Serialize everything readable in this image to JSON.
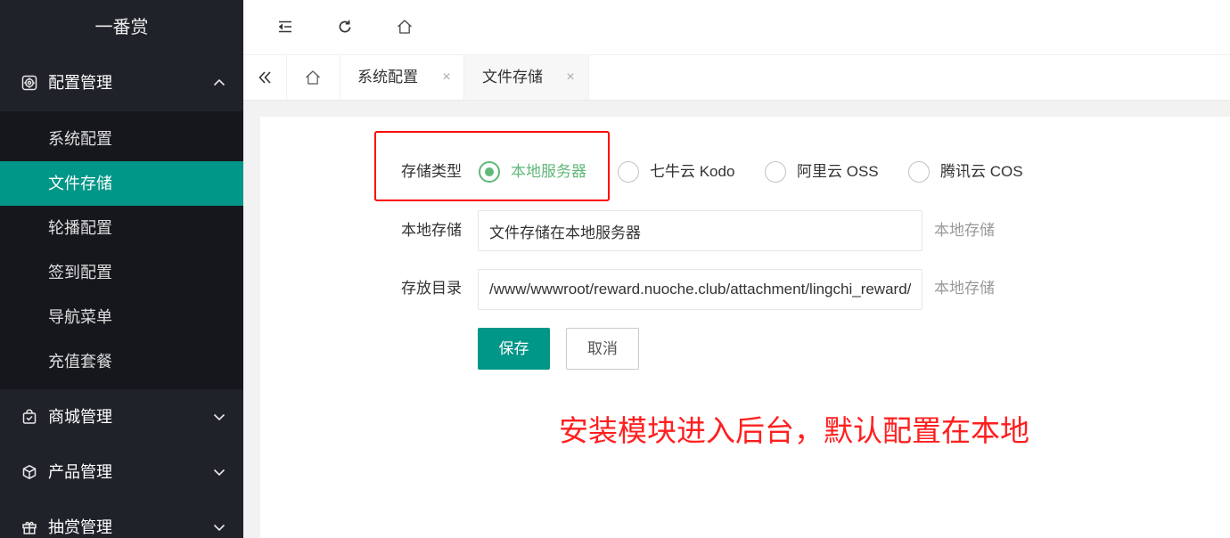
{
  "sidebar": {
    "logo": "一番赏",
    "groups": [
      {
        "label": "配置管理",
        "icon": "settings-icon",
        "expanded": true,
        "items": [
          {
            "label": "系统配置"
          },
          {
            "label": "文件存储",
            "active": true
          },
          {
            "label": "轮播配置"
          },
          {
            "label": "签到配置"
          },
          {
            "label": "导航菜单"
          },
          {
            "label": "充值套餐"
          }
        ]
      },
      {
        "label": "商城管理",
        "icon": "shopping-bag-check-icon",
        "expanded": false
      },
      {
        "label": "产品管理",
        "icon": "cube-icon",
        "expanded": false
      },
      {
        "label": "抽赏管理",
        "icon": "gift-icon",
        "expanded": false
      }
    ]
  },
  "header": {
    "icons": [
      "menu-fold-icon",
      "refresh-icon",
      "home-icon"
    ]
  },
  "tabs": {
    "collapse_icon": "double-chevron-left-icon",
    "home_icon": "home-icon",
    "items": [
      {
        "label": "系统配置",
        "close": "×"
      },
      {
        "label": "文件存储",
        "close": "×",
        "active": true
      }
    ]
  },
  "form": {
    "storage_type": {
      "label": "存储类型",
      "options": [
        {
          "label": "本地服务器",
          "checked": true
        },
        {
          "label": "七牛云 Kodo"
        },
        {
          "label": "阿里云 OSS"
        },
        {
          "label": "腾讯云 COS"
        }
      ]
    },
    "local_storage": {
      "label": "本地存储",
      "value": "文件存储在本地服务器",
      "aux": "本地存储"
    },
    "directory": {
      "label": "存放目录",
      "value": "/www/wwwroot/reward.nuoche.club/attachment/lingchi_reward/",
      "aux": "本地存储"
    },
    "buttons": {
      "save": "保存",
      "cancel": "取消"
    }
  },
  "annotation": {
    "text": "安装模块进入后台，默认配置在本地"
  },
  "colors": {
    "accent": "#009688",
    "radio_checked": "#5FB878",
    "sidebar_bg": "#20222A",
    "annotation": "#ff1f1f",
    "highlight_box": "#ff0000"
  }
}
